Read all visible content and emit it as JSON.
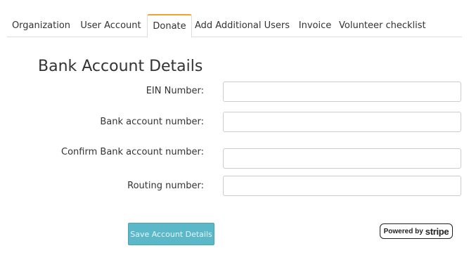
{
  "tabs": [
    {
      "label": "Organization",
      "active": false
    },
    {
      "label": "User Account",
      "active": false
    },
    {
      "label": "Donate",
      "active": true
    },
    {
      "label": "Add Additional Users",
      "active": false
    },
    {
      "label": "Invoice",
      "active": false
    },
    {
      "label": "Volunteer checklist",
      "active": false
    }
  ],
  "form": {
    "title": "Bank Account Details",
    "fields": [
      {
        "label": "EIN Number:",
        "value": "",
        "placeholder": ""
      },
      {
        "label": "Bank account number:",
        "value": "",
        "placeholder": ""
      },
      {
        "label": "Confirm Bank account number:",
        "value": "",
        "placeholder": ""
      },
      {
        "label": "Routing number:",
        "value": "",
        "placeholder": ""
      }
    ],
    "submit_label": "Save Account Details"
  },
  "stripe_badge": {
    "prefix": "Powered by",
    "brand": "stripe"
  },
  "colors": {
    "active_tab_accent": "#f0a32a",
    "button_background": "#5bb8c9",
    "border": "#dddddd"
  }
}
